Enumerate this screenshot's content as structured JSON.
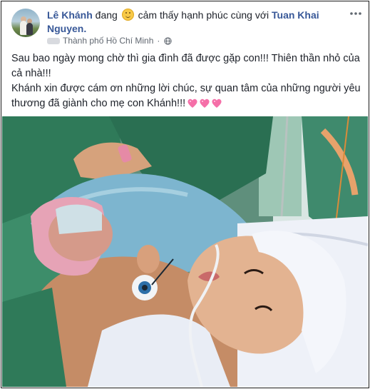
{
  "post": {
    "author": "Lê Khánh",
    "status_prefix": "đang",
    "feeling_icon": "smiling-face-icon",
    "status_middle": "cảm thấy hạnh phúc cùng với",
    "tagged_name": "Tuan Khai Nguyen.",
    "location": "Thành phố Hồ Chí Minh",
    "separator": "·",
    "privacy_icon": "globe-icon",
    "more_icon": "more-options-icon",
    "text_line1": "Sau bao ngày mong chờ thì gia đình đã được gặp con!!! Thiên thần nhỏ của cả nhà!!!",
    "text_line2": "Khánh xin được cám ơn những lời chúc, sự quan tâm của những người yêu thương đã giành cho mẹ con Khánh!!!",
    "hearts_icon": "heart-emoji-icon",
    "photo_subject": "photo"
  },
  "colors": {
    "link": "#385898",
    "text": "#1d2129",
    "meta": "#606770",
    "heart": "#f56fa8"
  }
}
